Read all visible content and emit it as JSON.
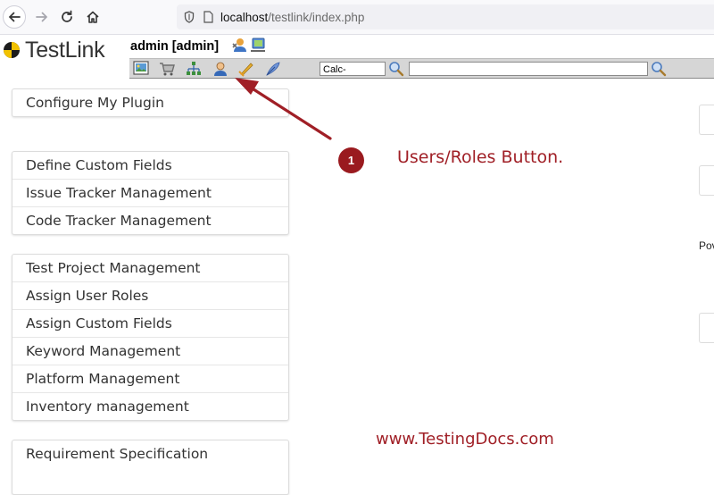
{
  "browser": {
    "url_host": "localhost",
    "url_path": "/testlink/index.php"
  },
  "app": {
    "logo_text": "TestLink",
    "user": "admin [admin]"
  },
  "toolbar": {
    "icons": [
      "desktop-icon",
      "cart-icon",
      "tree-icon",
      "user-icon",
      "events-icon",
      "feather-icon",
      "search-icon",
      "search-icon"
    ],
    "select_value": "Calc-"
  },
  "panels": [
    {
      "items": [
        "Configure My Plugin"
      ]
    },
    {
      "items": [
        "Define Custom Fields",
        "Issue Tracker Management",
        "Code Tracker Management"
      ]
    },
    {
      "items": [
        "Test Project Management",
        "Assign User Roles",
        "Assign Custom Fields",
        "Keyword Management",
        "Platform Management",
        "Inventory management"
      ]
    },
    {
      "items": [
        "Requirement Specification"
      ]
    }
  ],
  "right": {
    "pow_text": "Pov"
  },
  "annotation": {
    "number": "1",
    "label": "Users/Roles Button.",
    "watermark": "www.TestingDocs.com",
    "color": "#a01f26"
  }
}
